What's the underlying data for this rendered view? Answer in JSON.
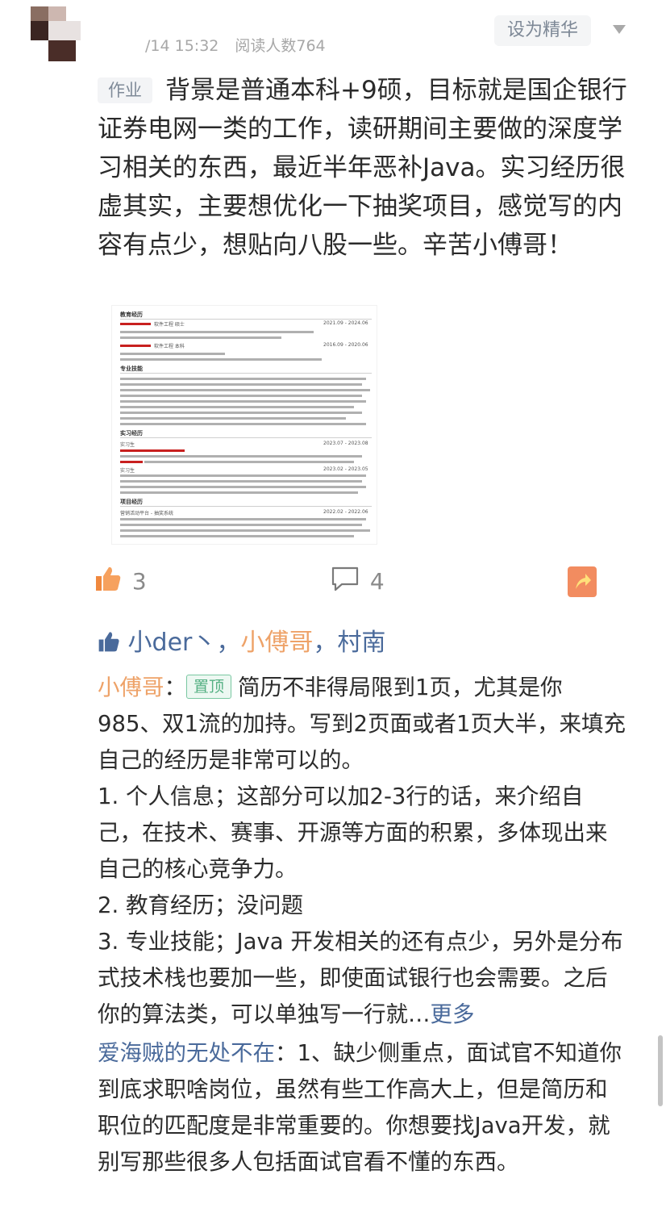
{
  "header": {
    "meta_time": "/14 15:32",
    "meta_reads": "阅读人数764",
    "essence_button": "设为精华"
  },
  "post": {
    "tag": "作业",
    "text": "背景是普通本科+9硕，目标就是国企银行证券电网一类的工作，读研期间主要做的深度学习相关的东西，最近半年恶补Java。实习经历很虚其实，主要想优化一下抽奖项目，感觉写的内容有点少，想贴向八股一些。辛苦小傅哥！"
  },
  "resume_thumb": {
    "sections": [
      "教育经历",
      "专业技能",
      "实习经历",
      "项目经历"
    ],
    "edu_rows": [
      {
        "label": "软件工程 硕士",
        "date": "2021.09 - 2024.06"
      },
      {
        "label": "软件工程 本科",
        "date": "2016.09 - 2020.06"
      }
    ],
    "intern_rows": [
      {
        "label": "实习生",
        "date": "2023.07 - 2023.08"
      },
      {
        "label": "实习生",
        "date": "2023.02 - 2023.05"
      }
    ],
    "project_row": {
      "label": "营销活动平台 - 抽奖系统",
      "date": "2022.02 - 2022.06"
    }
  },
  "actions": {
    "like_count": "3",
    "comment_count": "4",
    "icons": [
      "thumbs-up-icon",
      "comment-icon",
      "share-icon"
    ]
  },
  "likes": {
    "names": [
      "小der丶",
      "小傅哥",
      "村南"
    ],
    "sep": "，"
  },
  "comments": [
    {
      "author": "小傅哥",
      "colon": "：",
      "badge": "置顶",
      "text": "简历不非得局限到1页，尤其是你985、双1流的加持。写到2页面或者1页大半，来填充自己的经历是非常可以的。",
      "points": [
        "1. 个人信息；这部分可以加2-3行的话，来介绍自己，在技术、赛事、开源等方面的积累，多体现出来自己的核心竞争力。",
        "2. 教育经历；没问题",
        "3. 专业技能；Java 开发相关的还有点少，另外是分布式技术栈也要加一些，即使面试银行也会需要。之后你的算法类，可以单独写一行就…"
      ],
      "more": "更多"
    },
    {
      "author": "爱海贼的无处不在",
      "colon": "：",
      "text": "1、缺少侧重点，面试官不知道你到底求职啥岗位，虽然有些工作高大上，但是简历和职位的匹配度是非常重要的。你想要找Java开发，就别写那些很多人包括面试官看不懂的东西。"
    }
  ],
  "colors": {
    "author_orange": "#eea268",
    "link_blue": "#4a6a9b",
    "share_orange": "#f28c60",
    "pin_green": "#55b083"
  }
}
